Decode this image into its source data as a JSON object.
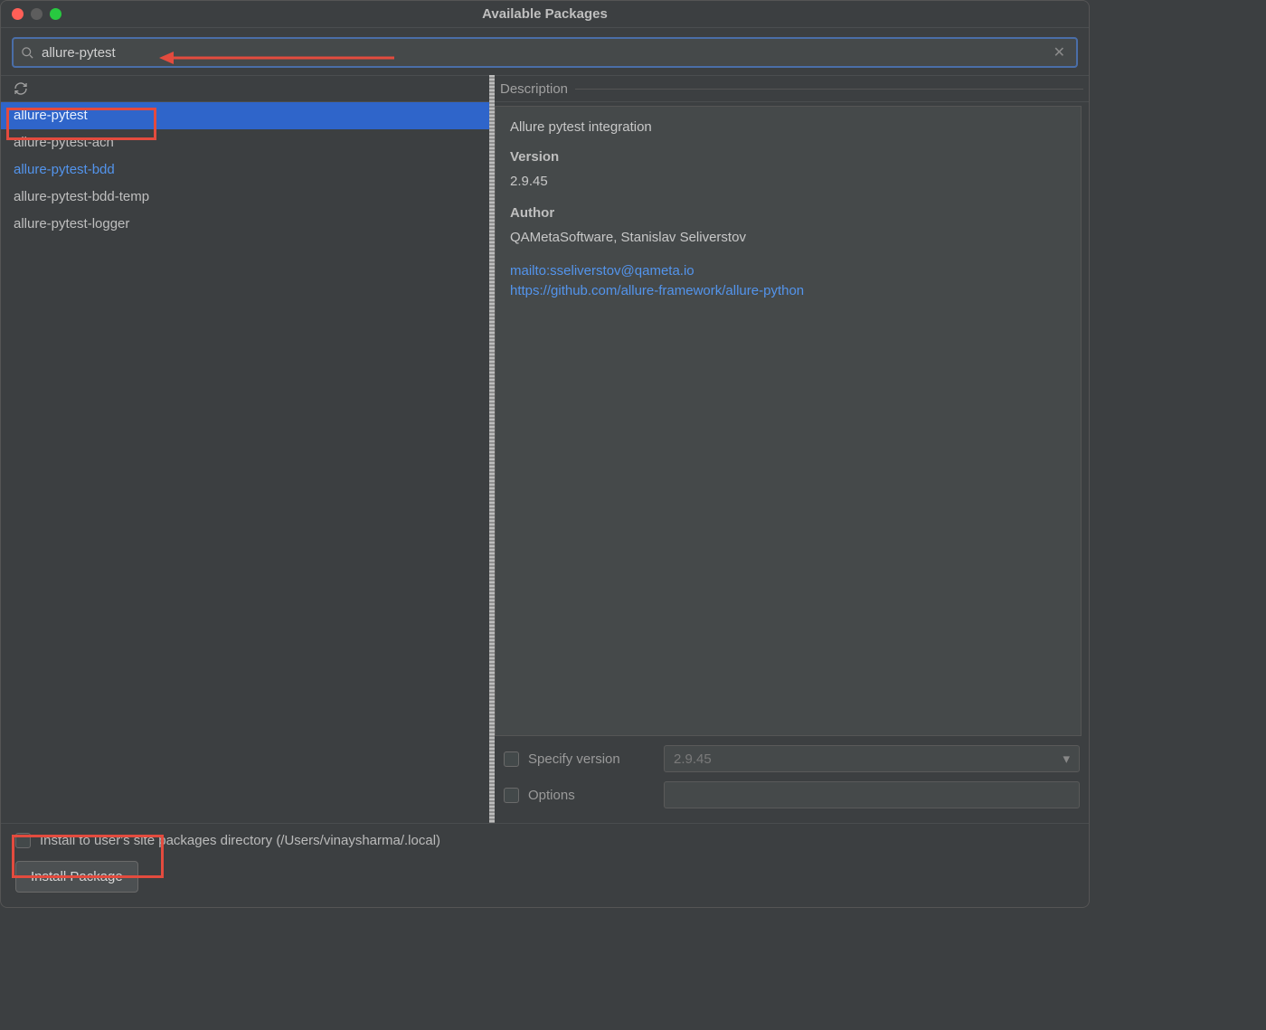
{
  "window": {
    "title": "Available Packages"
  },
  "search": {
    "value": "allure-pytest"
  },
  "packages": [
    {
      "name": "allure-pytest",
      "selected": true,
      "link": false
    },
    {
      "name": "allure-pytest-acn",
      "selected": false,
      "link": false
    },
    {
      "name": "allure-pytest-bdd",
      "selected": false,
      "link": true
    },
    {
      "name": "allure-pytest-bdd-temp",
      "selected": false,
      "link": false
    },
    {
      "name": "allure-pytest-logger",
      "selected": false,
      "link": false
    }
  ],
  "description": {
    "header": "Description",
    "summary": "Allure pytest integration",
    "version_label": "Version",
    "version": "2.9.45",
    "author_label": "Author",
    "author": "QAMetaSoftware, Stanislav Seliverstov",
    "links": [
      "mailto:sseliverstov@qameta.io",
      "https://github.com/allure-framework/allure-python"
    ]
  },
  "options": {
    "specify_version_label": "Specify version",
    "specify_version_value": "2.9.45",
    "options_label": "Options",
    "options_value": ""
  },
  "footer": {
    "site_packages_label": "Install to user's site packages directory (/Users/vinaysharma/.local)",
    "install_button": "Install Package"
  }
}
